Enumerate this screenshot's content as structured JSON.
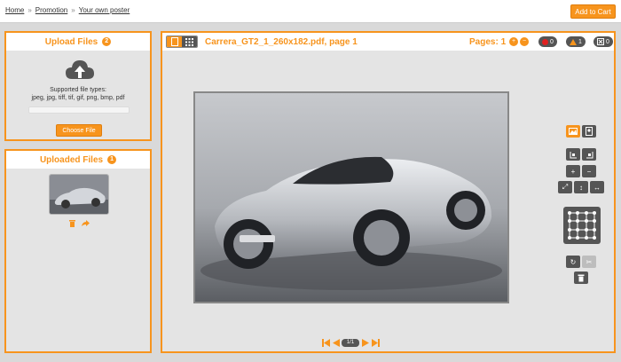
{
  "breadcrumb": {
    "home": "Home",
    "promotion": "Promotion",
    "current": "Your own poster"
  },
  "cart": {
    "label": "Add to Cart"
  },
  "upload": {
    "title": "Upload Files",
    "badge": "2",
    "types_title": "Supported file types:",
    "types_list": "jpeg, jpg, tiff, tif, gif, png, bmp, pdf",
    "button": "Choose File"
  },
  "uploaded": {
    "title": "Uploaded Files",
    "badge": "1"
  },
  "viewer": {
    "file_title": "Carrera_GT2_1_260x182.pdf, page 1",
    "pages_label": "Pages: 1",
    "chip_red": "0",
    "chip_warn": "1",
    "chip_x": "0"
  },
  "pager": {
    "count": "1/1"
  },
  "colors": {
    "accent": "#f7941d",
    "tool": "#555555",
    "canvas": "#e4e4e4"
  },
  "icons": [
    "cloud-upload-icon",
    "trash-icon",
    "share-icon",
    "single-page-icon",
    "grid-view-icon",
    "plus-icon",
    "minus-icon",
    "error-icon",
    "warning-icon",
    "landscape-icon",
    "portrait-icon",
    "rotate-icon",
    "delete-icon",
    "first-page-icon",
    "prev-page-icon",
    "next-page-icon",
    "last-page-icon"
  ]
}
